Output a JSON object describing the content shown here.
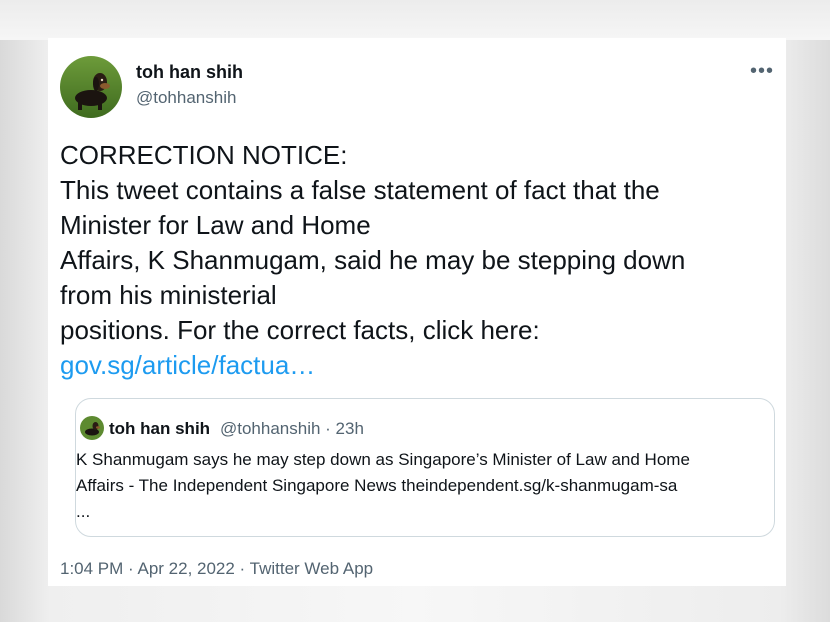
{
  "tweet": {
    "author_name": "toh han shih",
    "author_handle": "@tohhanshih",
    "more_label": "•••",
    "body_lines": [
      "CORRECTION NOTICE:",
      "This tweet contains a false statement of fact that the",
      "Minister for Law and Home",
      "Affairs, K Shanmugam, said he may be stepping down",
      "from his ministerial",
      "positions. For the correct facts, click here:"
    ],
    "link_text": "gov.sg/article/factua…",
    "footer": "1:04 PM · Apr 22, 2022 · Twitter Web App"
  },
  "quote": {
    "author_name": "toh han shih",
    "meta": "@tohhanshih · 23h",
    "text_lines": [
      "K Shanmugam says he may step down as Singapore’s Minister of Law and Home",
      "Affairs - The Independent Singapore News theindependent.sg/k-shanmugam-sa",
      "..."
    ]
  },
  "colors": {
    "text": "#0f1419",
    "muted": "#536471",
    "link": "#1d9bf0",
    "border": "#cfd9de"
  }
}
